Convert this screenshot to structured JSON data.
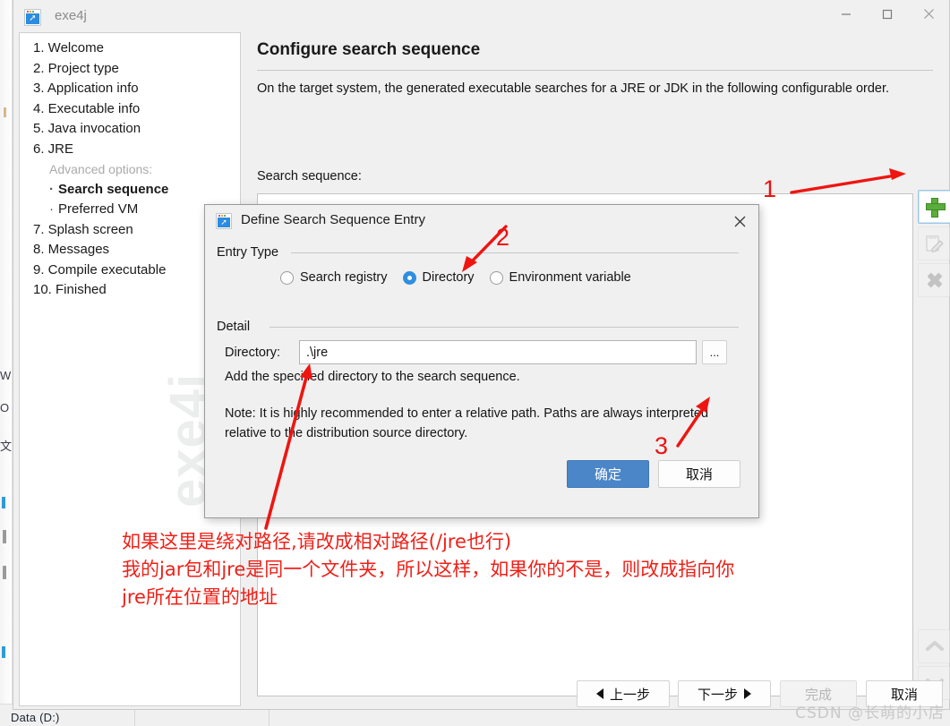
{
  "window": {
    "title": "exe4j",
    "icon": "rocket-icon",
    "minimize_label": "—",
    "maximize_label": "□",
    "close_label": "✕"
  },
  "sidebar": {
    "watermark": "exe4j",
    "items": [
      {
        "label": "1. Welcome",
        "kind": "step"
      },
      {
        "label": "2. Project type",
        "kind": "step"
      },
      {
        "label": "3. Application info",
        "kind": "step"
      },
      {
        "label": "4. Executable info",
        "kind": "step"
      },
      {
        "label": "5. Java invocation",
        "kind": "step"
      },
      {
        "label": "6. JRE",
        "kind": "step"
      },
      {
        "label": "Advanced options:",
        "kind": "muted"
      },
      {
        "label": "Search sequence",
        "kind": "sub-active"
      },
      {
        "label": "Preferred VM",
        "kind": "sub"
      },
      {
        "label": "7. Splash screen",
        "kind": "step"
      },
      {
        "label": "8. Messages",
        "kind": "step"
      },
      {
        "label": "9. Compile executable",
        "kind": "step"
      },
      {
        "label": "10. Finished",
        "kind": "step"
      }
    ]
  },
  "main": {
    "page_title": "Configure search sequence",
    "intro": "On the target system, the generated executable searches for a JRE or JDK in the following configurable order.",
    "sequence_label": "Search sequence:",
    "sequence_items": [],
    "toolbar": {
      "add": {
        "name": "add-entry-button",
        "icon": "plus-icon",
        "enabled": true,
        "focused": true
      },
      "edit": {
        "name": "edit-entry-button",
        "icon": "pencil-icon",
        "enabled": false
      },
      "remove": {
        "name": "remove-entry-button",
        "icon": "x-icon",
        "enabled": false
      },
      "move_up": {
        "name": "move-up-button",
        "icon": "chevron-up-icon",
        "enabled": false
      },
      "move_down": {
        "name": "move-down-button",
        "icon": "chevron-down-icon",
        "enabled": false
      }
    }
  },
  "wizard_buttons": {
    "previous": "上一步",
    "next": "下一步",
    "finish": "完成",
    "cancel": "取消",
    "finish_enabled": false
  },
  "dialog": {
    "title": "Define Search Sequence Entry",
    "icon": "rocket-icon",
    "close_label": "✕",
    "entry_type": {
      "group_label": "Entry Type",
      "options": [
        {
          "label": "Search registry",
          "selected": false
        },
        {
          "label": "Directory",
          "selected": true
        },
        {
          "label": "Environment variable",
          "selected": false
        }
      ]
    },
    "detail": {
      "group_label": "Detail",
      "directory_label": "Directory:",
      "directory_value": ".\\jre",
      "directory_placeholder": "",
      "browse_label": "...",
      "help_line_1": "Add the specified directory to the search sequence.",
      "help_line_2": "Note: It is highly recommended to enter a relative path. Paths are always interpreted relative to the distribution source directory."
    },
    "ok_label": "确定",
    "cancel_label": "取消"
  },
  "annotations": {
    "step_1": "1",
    "step_2": "2",
    "step_3": "3",
    "note_line_1": "如果这里是绕对路径,请改成相对路径(/jre也行)",
    "note_line_2": "我的jar包和jre是同一个文件夹，所以这样，如果你的不是，则改成指向你",
    "note_line_3": "jre所在位置的地址",
    "color": "#f01f17"
  },
  "background": {
    "taskbar_label": "Data (D:)",
    "glyphs": [
      "W",
      "O",
      "文"
    ]
  },
  "watermark": {
    "csdn": "CSDN @长萌的小店"
  }
}
